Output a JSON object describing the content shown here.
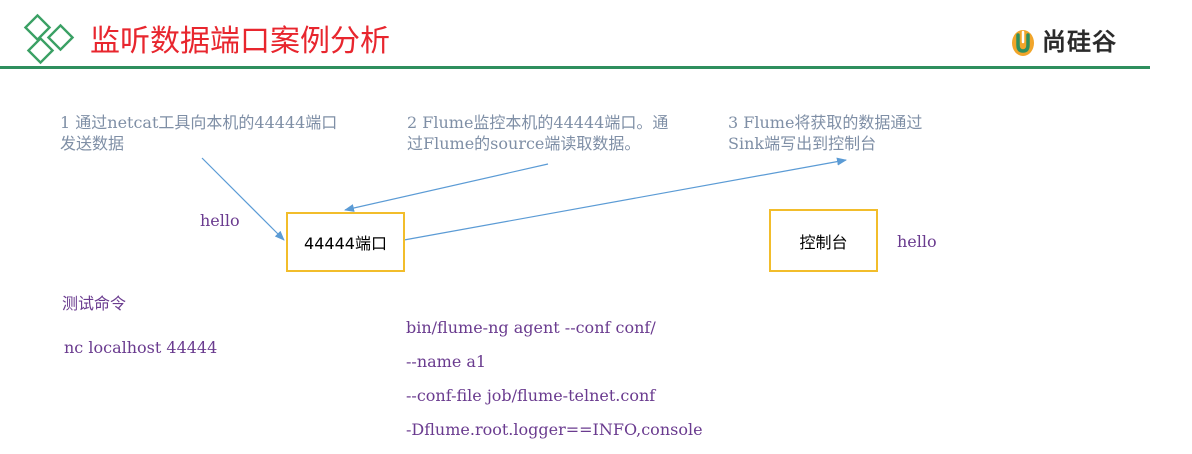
{
  "header": {
    "title": "监听数据端口案例分析",
    "brand": "尚硅谷"
  },
  "colors": {
    "title_red": "#e8262e",
    "rule_green": "#2f8f5e",
    "logo_green": "#3aa064",
    "step_gray": "#7f8fa6",
    "purple": "#6a3b8f",
    "box_border": "#f2bd2b",
    "arrow_blue": "#5b9bd5",
    "brand_orange": "#f1a52a"
  },
  "steps": [
    "1 通过netcat工具向本机的44444端口发送数据",
    "2 Flume监控本机的44444端口。通过Flume的source端读取数据。",
    "3 Flume将获取的数据通过Sink端写出到控制台"
  ],
  "labels": {
    "hello_left": "hello",
    "hello_right": "hello"
  },
  "boxes": {
    "port": "44444端口",
    "console": "控制台"
  },
  "commands": {
    "title": "测试命令",
    "test": "nc localhost 44444",
    "flume": [
      "bin/flume-ng agent --conf conf/",
      "--name a1",
      "--conf-file job/flume-telnet.conf",
      "-Dflume.root.logger==INFO,console"
    ]
  }
}
